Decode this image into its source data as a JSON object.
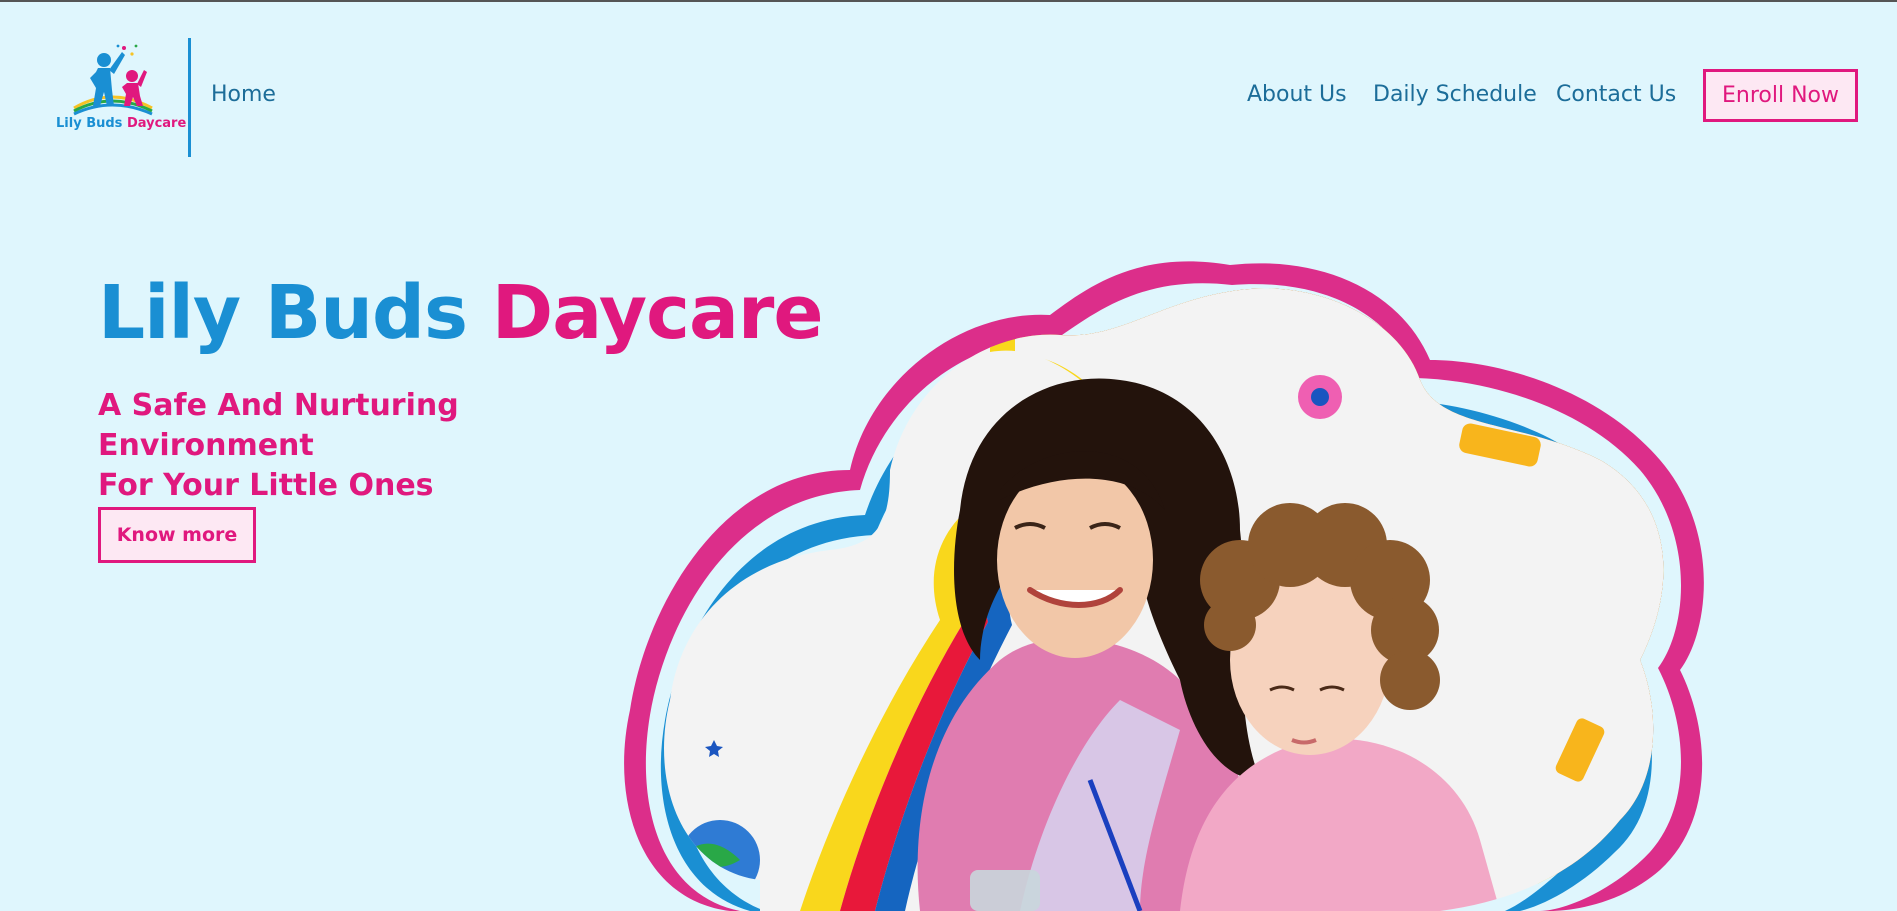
{
  "brand": {
    "logo_part1": "Lily Buds",
    "logo_part2": "Daycare",
    "blue": "#1a8fd3",
    "pink": "#e0187e",
    "background": "#dff6fd"
  },
  "nav": {
    "home": "Home",
    "about": "About Us",
    "schedule": "Daily Schedule",
    "contact": "Contact Us",
    "enroll": "Enroll Now"
  },
  "hero": {
    "title_part1": "Lily Buds",
    "title_part2": "Daycare",
    "subtitle_line1": "A Safe And Nurturing Environment",
    "subtitle_line2": "For Your Little Ones",
    "cta": "Know more"
  },
  "icons": [
    "logo-children-icon",
    "flower-icon",
    "globe-icon",
    "star-icon"
  ]
}
